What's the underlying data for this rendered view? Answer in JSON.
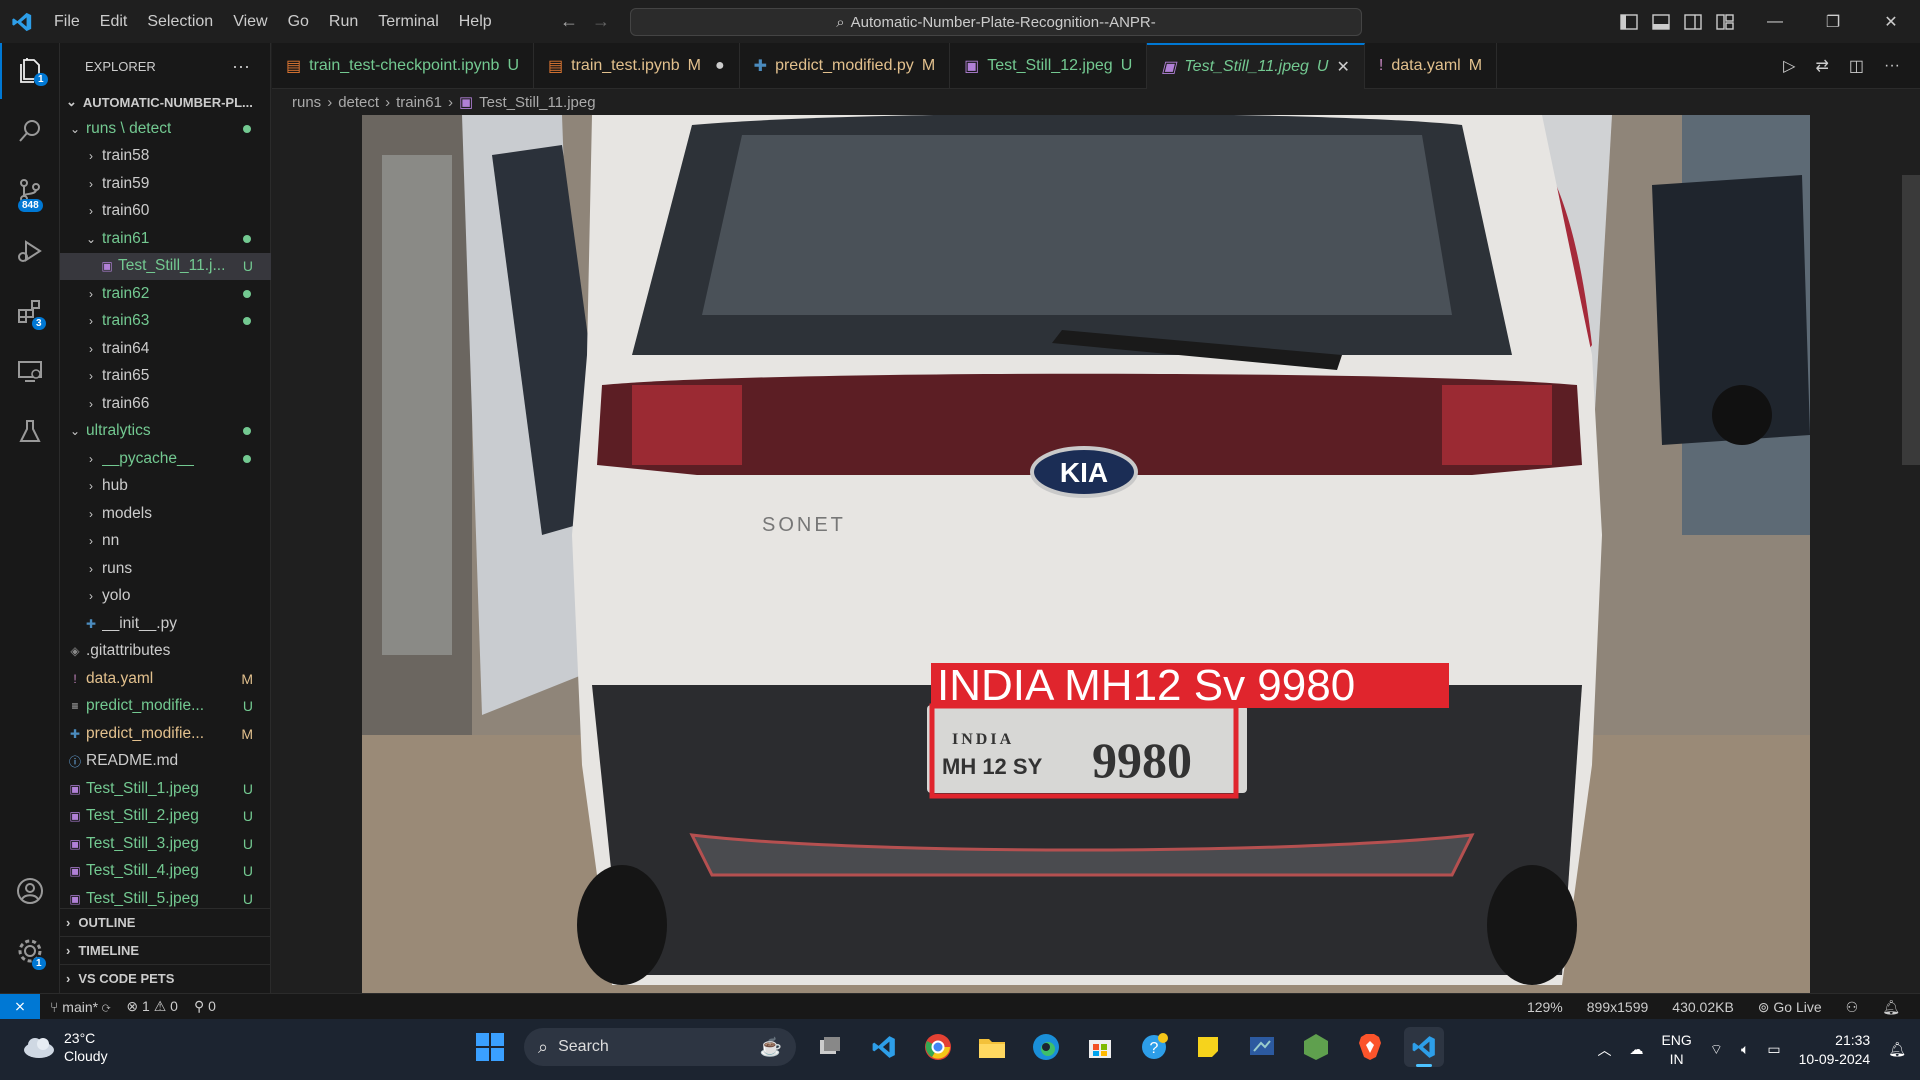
{
  "menu": [
    "File",
    "Edit",
    "Selection",
    "View",
    "Go",
    "Run",
    "Terminal",
    "Help"
  ],
  "title": "Automatic-Number-Plate-Recognition--ANPR-",
  "activity_badges": {
    "explorer": "1",
    "source_control": "848",
    "extensions": "3",
    "settings": "1"
  },
  "explorer": {
    "header": "EXPLORER",
    "project": "AUTOMATIC-NUMBER-PL...",
    "tree": [
      {
        "label": "runs \\ detect",
        "chev": "⌄",
        "indent": 1,
        "color": "green",
        "dot": true
      },
      {
        "label": "train58",
        "chev": "›",
        "indent": 2
      },
      {
        "label": "train59",
        "chev": "›",
        "indent": 2
      },
      {
        "label": "train60",
        "chev": "›",
        "indent": 2
      },
      {
        "label": "train61",
        "chev": "⌄",
        "indent": 2,
        "color": "green",
        "dot": true
      },
      {
        "label": "Test_Still_11.j...",
        "indent": 3,
        "color": "green",
        "status": "U",
        "icon": "image",
        "selected": true
      },
      {
        "label": "train62",
        "chev": "›",
        "indent": 2,
        "color": "green",
        "dot": true
      },
      {
        "label": "train63",
        "chev": "›",
        "indent": 2,
        "color": "green",
        "dot": true
      },
      {
        "label": "train64",
        "chev": "›",
        "indent": 2
      },
      {
        "label": "train65",
        "chev": "›",
        "indent": 2
      },
      {
        "label": "train66",
        "chev": "›",
        "indent": 2
      },
      {
        "label": "ultralytics",
        "chev": "⌄",
        "indent": 1,
        "color": "green",
        "dot": true
      },
      {
        "label": "__pycache__",
        "chev": "›",
        "indent": 2,
        "color": "green",
        "dot": true
      },
      {
        "label": "hub",
        "chev": "›",
        "indent": 2
      },
      {
        "label": "models",
        "chev": "›",
        "indent": 2
      },
      {
        "label": "nn",
        "chev": "›",
        "indent": 2
      },
      {
        "label": "runs",
        "chev": "›",
        "indent": 2
      },
      {
        "label": "yolo",
        "chev": "›",
        "indent": 2
      },
      {
        "label": "__init__.py",
        "indent": 2,
        "icon": "python"
      },
      {
        "label": ".gitattributes",
        "indent": 1,
        "icon": "git"
      },
      {
        "label": "data.yaml",
        "indent": 1,
        "color": "yel",
        "status": "M",
        "icon": "yaml"
      },
      {
        "label": "predict_modifie...",
        "indent": 1,
        "color": "green",
        "status": "U",
        "icon": "text"
      },
      {
        "label": "predict_modifie...",
        "indent": 1,
        "color": "yel",
        "status": "M",
        "icon": "python"
      },
      {
        "label": "README.md",
        "indent": 1,
        "icon": "info"
      },
      {
        "label": "Test_Still_1.jpeg",
        "indent": 1,
        "color": "green",
        "status": "U",
        "icon": "image"
      },
      {
        "label": "Test_Still_2.jpeg",
        "indent": 1,
        "color": "green",
        "status": "U",
        "icon": "image"
      },
      {
        "label": "Test_Still_3.jpeg",
        "indent": 1,
        "color": "green",
        "status": "U",
        "icon": "image"
      },
      {
        "label": "Test_Still_4.jpeg",
        "indent": 1,
        "color": "green",
        "status": "U",
        "icon": "image"
      },
      {
        "label": "Test_Still_5.jpeg",
        "indent": 1,
        "color": "green",
        "status": "U",
        "icon": "image"
      }
    ],
    "sections": [
      "OUTLINE",
      "TIMELINE",
      "VS CODE PETS"
    ]
  },
  "tabs": [
    {
      "label": "train_test-checkpoint.ipynb",
      "status": "U",
      "color": "green",
      "icon": "notebook"
    },
    {
      "label": "train_test.ipynb",
      "status": "M",
      "color": "yel",
      "icon": "notebook",
      "dirty": true
    },
    {
      "label": "predict_modified.py",
      "status": "M",
      "color": "yel",
      "icon": "python"
    },
    {
      "label": "Test_Still_12.jpeg",
      "status": "U",
      "color": "green",
      "icon": "image"
    },
    {
      "label": "Test_Still_11.jpeg",
      "status": "U",
      "color": "green",
      "icon": "image",
      "active": true
    },
    {
      "label": "data.yaml",
      "status": "M",
      "color": "yel",
      "icon": "yaml"
    }
  ],
  "breadcrumb": [
    "runs",
    "detect",
    "train61",
    "Test_Still_11.jpeg"
  ],
  "image": {
    "detection_label": "INDIA MH12 Sv 9980",
    "brand": "KIA",
    "model": "SONET",
    "plate_line1": "INDIA",
    "plate_line2": "MH 12 SY",
    "plate_number": "9980"
  },
  "status": {
    "branch": "main*",
    "errors": "1",
    "warnings": "0",
    "ports": "0",
    "zoom": "129%",
    "dimensions": "899x1599",
    "size": "430.02KB",
    "golive": "Go Live"
  },
  "taskbar": {
    "temp": "23°C",
    "weather": "Cloudy",
    "search": "Search",
    "lang1": "ENG",
    "lang2": "IN",
    "time": "21:33",
    "date": "10-09-2024"
  }
}
